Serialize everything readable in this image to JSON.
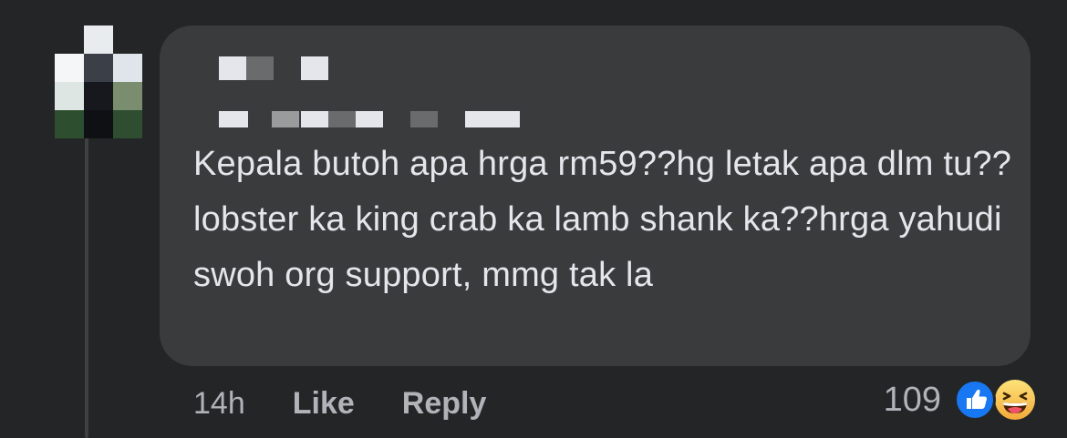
{
  "comment": {
    "text": "Kepala butoh apa hrga rm59??hg letak apa dlm tu??lobster ka king crab ka lamb shank ka??hrga yahudi swoh org support, mmg tak la"
  },
  "actions": {
    "timestamp": "14h",
    "like_label": "Like",
    "reply_label": "Reply"
  },
  "reactions": {
    "count": "109",
    "icons": [
      "like-icon",
      "haha-icon"
    ]
  },
  "colors": {
    "background": "#242526",
    "bubble": "#3a3b3c",
    "text": "#e4e6eb",
    "secondary_text": "#b0b3b8",
    "like_blue": "#1877f2",
    "haha_yellow": "#f7b125"
  }
}
